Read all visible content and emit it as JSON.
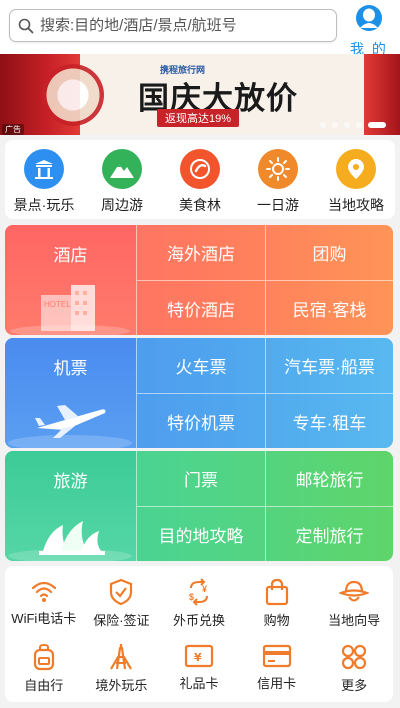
{
  "search": {
    "placeholder": "搜索:目的地/酒店/景点/航班号"
  },
  "profile": {
    "label": "我 的"
  },
  "banner": {
    "brand": "携程旅行网",
    "headline": "国庆大放价",
    "subline": "返现高达19%",
    "ad_tag": "广告",
    "slide_count": 5,
    "active_slide": 5
  },
  "quick_nav": [
    {
      "label": "景点·玩乐",
      "icon": "temple-icon",
      "color": "#2d8ff0"
    },
    {
      "label": "周边游",
      "icon": "mountain-icon",
      "color": "#34b25a"
    },
    {
      "label": "美食林",
      "icon": "food-icon",
      "color": "#f2552c"
    },
    {
      "label": "一日游",
      "icon": "sun-icon",
      "color": "#f0892a"
    },
    {
      "label": "当地攻略",
      "icon": "location-pin-icon",
      "color": "#f5ad1f"
    }
  ],
  "hotel_block": {
    "main": "酒店",
    "cells": [
      "海外酒店",
      "团购",
      "特价酒店",
      "民宿·客栈"
    ],
    "color": "#ff6b6b"
  },
  "flight_block": {
    "main": "机票",
    "cells": [
      "火车票",
      "汽车票·船票",
      "特价机票",
      "专车·租车"
    ],
    "color": "#4d8ff0"
  },
  "travel_block": {
    "main": "旅游",
    "cells": [
      "门票",
      "邮轮旅行",
      "目的地攻略",
      "定制旅行"
    ],
    "color": "#3fd0a0"
  },
  "services": [
    {
      "label": "WiFi电话卡",
      "icon": "wifi-icon"
    },
    {
      "label": "保险·签证",
      "icon": "shield-icon"
    },
    {
      "label": "外币兑换",
      "icon": "currency-exchange-icon"
    },
    {
      "label": "购物",
      "icon": "shopping-bag-icon"
    },
    {
      "label": "当地向导",
      "icon": "guide-hat-icon"
    },
    {
      "label": "自由行",
      "icon": "backpack-icon"
    },
    {
      "label": "境外玩乐",
      "icon": "tower-icon"
    },
    {
      "label": "礼品卡",
      "icon": "gift-card-icon"
    },
    {
      "label": "信用卡",
      "icon": "credit-card-icon"
    },
    {
      "label": "更多",
      "icon": "more-grid-icon"
    }
  ],
  "accent_color": "#f07b2a"
}
